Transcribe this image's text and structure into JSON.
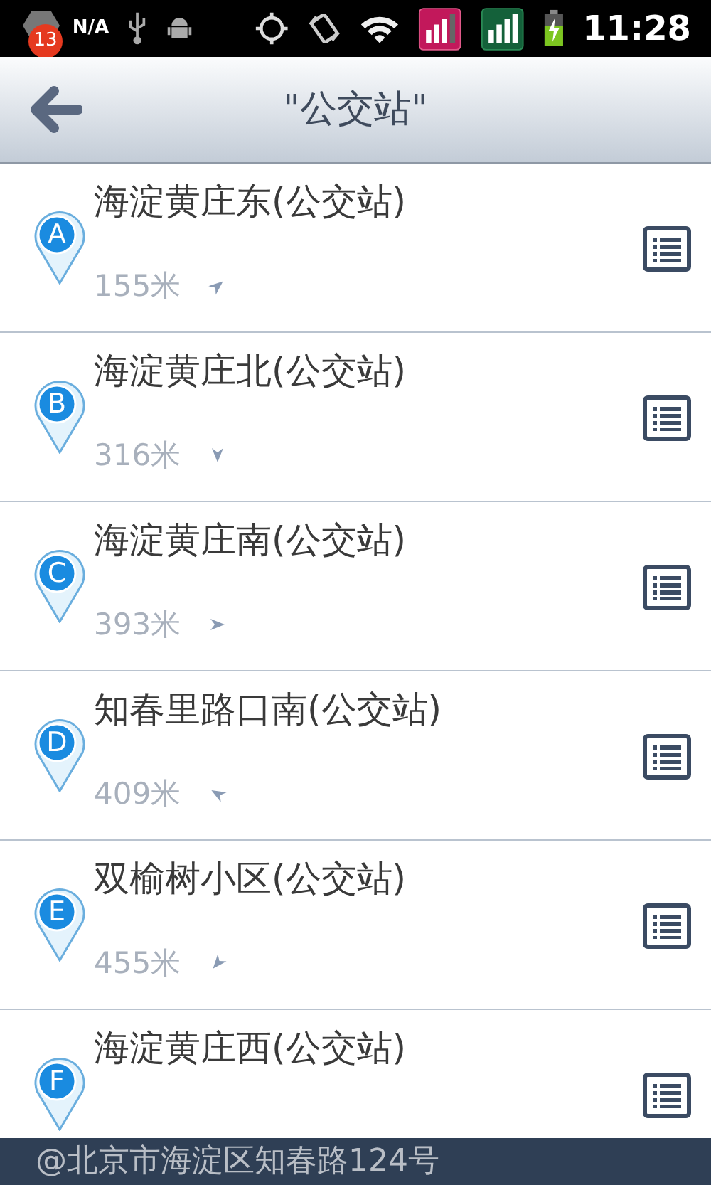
{
  "status_bar": {
    "notification_count": "13",
    "carrier": "N/A",
    "time": "11:28"
  },
  "header": {
    "title": "\"公交站\""
  },
  "stops": [
    {
      "marker": "A",
      "name": "海淀黄庄东(公交站)",
      "distance": "155米",
      "kind": "northeast"
    },
    {
      "marker": "B",
      "name": "海淀黄庄北(公交站)",
      "distance": "316米",
      "kind": "south"
    },
    {
      "marker": "C",
      "name": "海淀黄庄南(公交站)",
      "distance": "393米",
      "kind": "east"
    },
    {
      "marker": "D",
      "name": "知春里路口南(公交站)",
      "distance": "409米",
      "kind": "northwest"
    },
    {
      "marker": "E",
      "name": "双榆树小区(公交站)",
      "distance": "455米",
      "kind": "southwest"
    },
    {
      "marker": "F",
      "name": "海淀黄庄西(公交站)"
    }
  ],
  "footer": {
    "location": "@北京市海淀区知春路124号"
  }
}
